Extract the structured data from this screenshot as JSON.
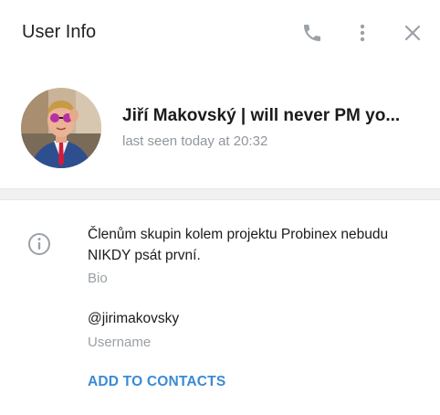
{
  "header": {
    "title": "User Info",
    "icons": [
      "phone-icon",
      "more-vertical-icon",
      "close-icon"
    ]
  },
  "profile": {
    "name": "Jiří Makovský | will never PM yo...",
    "status": "last seen today at 20:32"
  },
  "details": {
    "bio_text": "Členům skupin kolem projektu Probinex nebudu NIKDY psát první.",
    "bio_label": "Bio",
    "username": "@jirimakovsky",
    "username_label": "Username",
    "add_contacts_label": "ADD TO CONTACTS"
  },
  "colors": {
    "accent": "#3a8ad4",
    "muted": "#8f969c",
    "icon": "#9aa1a7"
  }
}
